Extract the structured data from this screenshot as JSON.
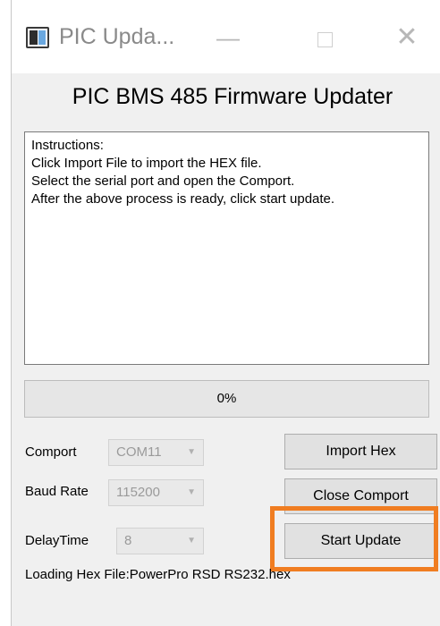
{
  "window": {
    "title": "PIC Upda...",
    "minimize_glyph": "—",
    "close_glyph": "✕"
  },
  "heading": "PIC BMS 485 Firmware Updater",
  "instructions": {
    "lines": [
      "Instructions:",
      "Click Import File to import the HEX file.",
      "Select the serial port and open the Comport.",
      "After the above process is ready, click start update."
    ]
  },
  "progress": {
    "value": 0,
    "label": "0%"
  },
  "fields": {
    "comport": {
      "label": "Comport",
      "value": "COM11"
    },
    "baud_rate": {
      "label": "Baud Rate",
      "value": "115200"
    },
    "delay_time": {
      "label": "DelayTime",
      "value": "8"
    }
  },
  "buttons": {
    "import_hex": "Import Hex",
    "close_comport": "Close Comport",
    "start_update": "Start Update"
  },
  "status": "Loading Hex File:PowerPro RSD RS232.hex",
  "colors": {
    "highlight": "#f07d21",
    "progress_fill": "#06b025"
  }
}
